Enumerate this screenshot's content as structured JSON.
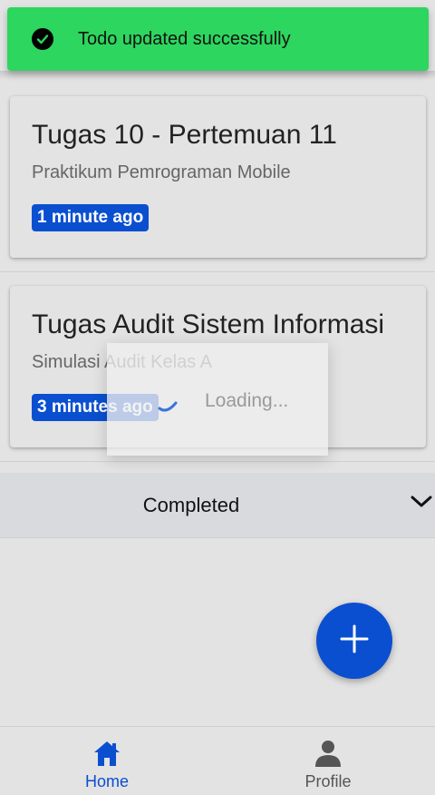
{
  "toast": {
    "message": "Todo updated successfully",
    "icon": "check-circle-icon",
    "color": "#2dd65f"
  },
  "todos": [
    {
      "title": "Tugas 10 - Pertemuan 11",
      "subtitle": "Praktikum Pemrograman Mobile",
      "time": "1 minute ago"
    },
    {
      "title": "Tugas Audit Sistem Informasi",
      "subtitle": "Simulasi Audit Kelas A",
      "time": "3 minutes ago"
    }
  ],
  "completed": {
    "label": "Completed",
    "icon": "chevron-down-icon"
  },
  "loading": {
    "text": "Loading..."
  },
  "fab": {
    "icon": "plus-icon"
  },
  "tabs": [
    {
      "label": "Home",
      "icon": "home-icon",
      "active": true
    },
    {
      "label": "Profile",
      "icon": "person-icon",
      "active": false
    }
  ],
  "colors": {
    "accent": "#0a4fd0",
    "background": "#e3e3e3",
    "inactive_tab": "#555555"
  }
}
